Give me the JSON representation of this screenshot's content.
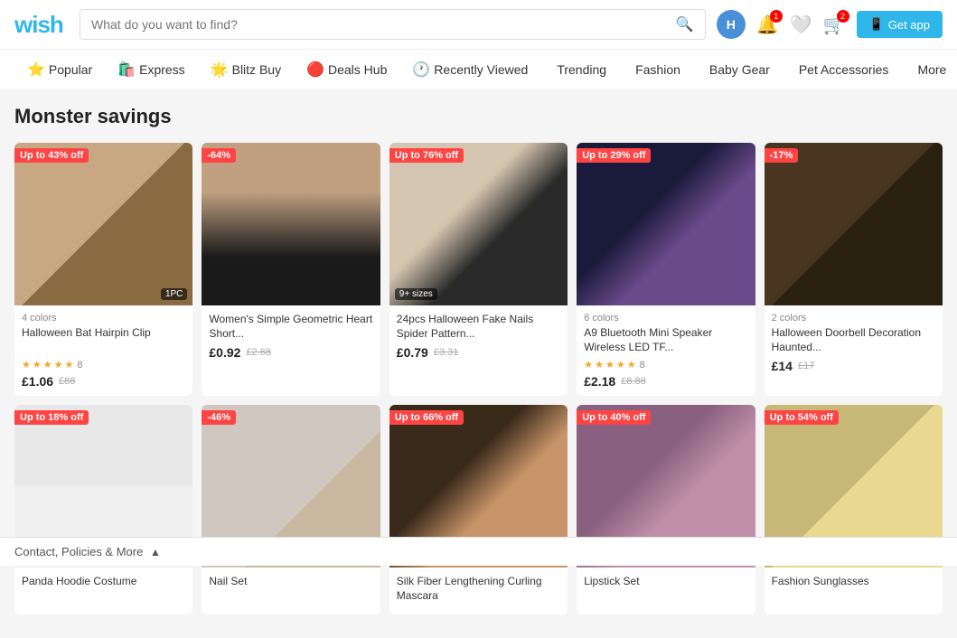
{
  "header": {
    "logo": "wish",
    "search_placeholder": "What do you want to find?",
    "avatar_letter": "H",
    "notification_badge": "1",
    "cart_badge": "2",
    "get_app_label": "Get app"
  },
  "nav": {
    "items": [
      {
        "id": "popular",
        "icon": "⭐",
        "label": "Popular"
      },
      {
        "id": "express",
        "icon": "🛍️",
        "label": "Express"
      },
      {
        "id": "blitz-buy",
        "icon": "🌟",
        "label": "Blitz Buy"
      },
      {
        "id": "deals-hub",
        "icon": "🔴",
        "label": "Deals Hub"
      },
      {
        "id": "recently-viewed",
        "icon": "🕐",
        "label": "Recently Viewed"
      },
      {
        "id": "trending",
        "icon": "",
        "label": "Trending"
      },
      {
        "id": "fashion",
        "icon": "",
        "label": "Fashion"
      },
      {
        "id": "baby-gear",
        "icon": "",
        "label": "Baby Gear"
      },
      {
        "id": "pet-accessories",
        "icon": "",
        "label": "Pet Accessories"
      },
      {
        "id": "more",
        "icon": "",
        "label": "More"
      }
    ]
  },
  "main": {
    "section_title": "Monster savings",
    "rows": [
      [
        {
          "id": "bat-hairpin",
          "discount": "Up to 43% off",
          "colors": "4 colors",
          "name": "Halloween Bat Hairpin Clip",
          "stars": 5,
          "review_count": "8",
          "price_current": "£1.06",
          "price_original": "£88",
          "corner_badge": "1PC",
          "img_class": "img-bat"
        },
        {
          "id": "heart-necklace",
          "discount": "-64%",
          "colors": "",
          "name": "Women's Simple Geometric Heart Short...",
          "stars": 0,
          "review_count": "",
          "price_current": "£0.92",
          "price_original": "£2.68",
          "corner_badge": "",
          "img_class": "img-necklace"
        },
        {
          "id": "fake-nails",
          "discount": "Up to 76% off",
          "colors": "",
          "name": "24pcs Halloween Fake Nails Spider Pattern...",
          "stars": 0,
          "review_count": "",
          "price_current": "£0.79",
          "price_original": "£3.31",
          "size_badge": "9+ sizes",
          "corner_badge": "",
          "img_class": "img-nails"
        },
        {
          "id": "bluetooth-speaker",
          "discount": "Up to 29% off",
          "colors": "6 colors",
          "name": "A9 Bluetooth Mini Speaker Wireless LED TF...",
          "stars": 5,
          "review_count": "8",
          "price_current": "£2.18",
          "price_original": "£8.88",
          "corner_badge": "",
          "img_class": "img-speaker"
        },
        {
          "id": "halloween-doorbell",
          "discount": "-17%",
          "colors": "2 colors",
          "name": "Halloween Doorbell Decoration Haunted...",
          "stars": 0,
          "review_count": "",
          "price_current": "£14",
          "price_original": "£17",
          "corner_badge": "",
          "img_class": "img-doorbell"
        }
      ],
      [
        {
          "id": "panda-hoodie",
          "discount": "Up to 18% off",
          "colors": "",
          "name": "Panda Hoodie Costume",
          "stars": 0,
          "review_count": "",
          "price_current": "",
          "price_original": "",
          "corner_badge": "",
          "img_class": "img-panda"
        },
        {
          "id": "nail-set",
          "discount": "-46%",
          "colors": "",
          "name": "Nail Set",
          "stars": 0,
          "review_count": "",
          "price_current": "",
          "price_original": "",
          "corner_badge": "",
          "img_class": "img-nails2"
        },
        {
          "id": "mascara",
          "discount": "Up to 66% off",
          "colors": "",
          "name": "Silk Fiber Lengthening Curling Mascara",
          "stars": 0,
          "review_count": "",
          "price_current": "",
          "price_original": "",
          "corner_badge": "",
          "img_class": "img-mascara"
        },
        {
          "id": "lipstick",
          "discount": "Up to 40% off",
          "colors": "",
          "name": "Lipstick Set",
          "stars": 0,
          "review_count": "",
          "price_current": "",
          "price_original": "",
          "corner_badge": "",
          "img_class": "img-lipstick"
        },
        {
          "id": "glasses",
          "discount": "Up to 54% off",
          "colors": "",
          "name": "Fashion Sunglasses",
          "stars": 0,
          "review_count": "",
          "price_current": "",
          "price_original": "",
          "corner_badge": "",
          "img_class": "img-glasses"
        }
      ]
    ]
  },
  "footer": {
    "label": "Contact, Policies & More",
    "chevron": "▲"
  }
}
